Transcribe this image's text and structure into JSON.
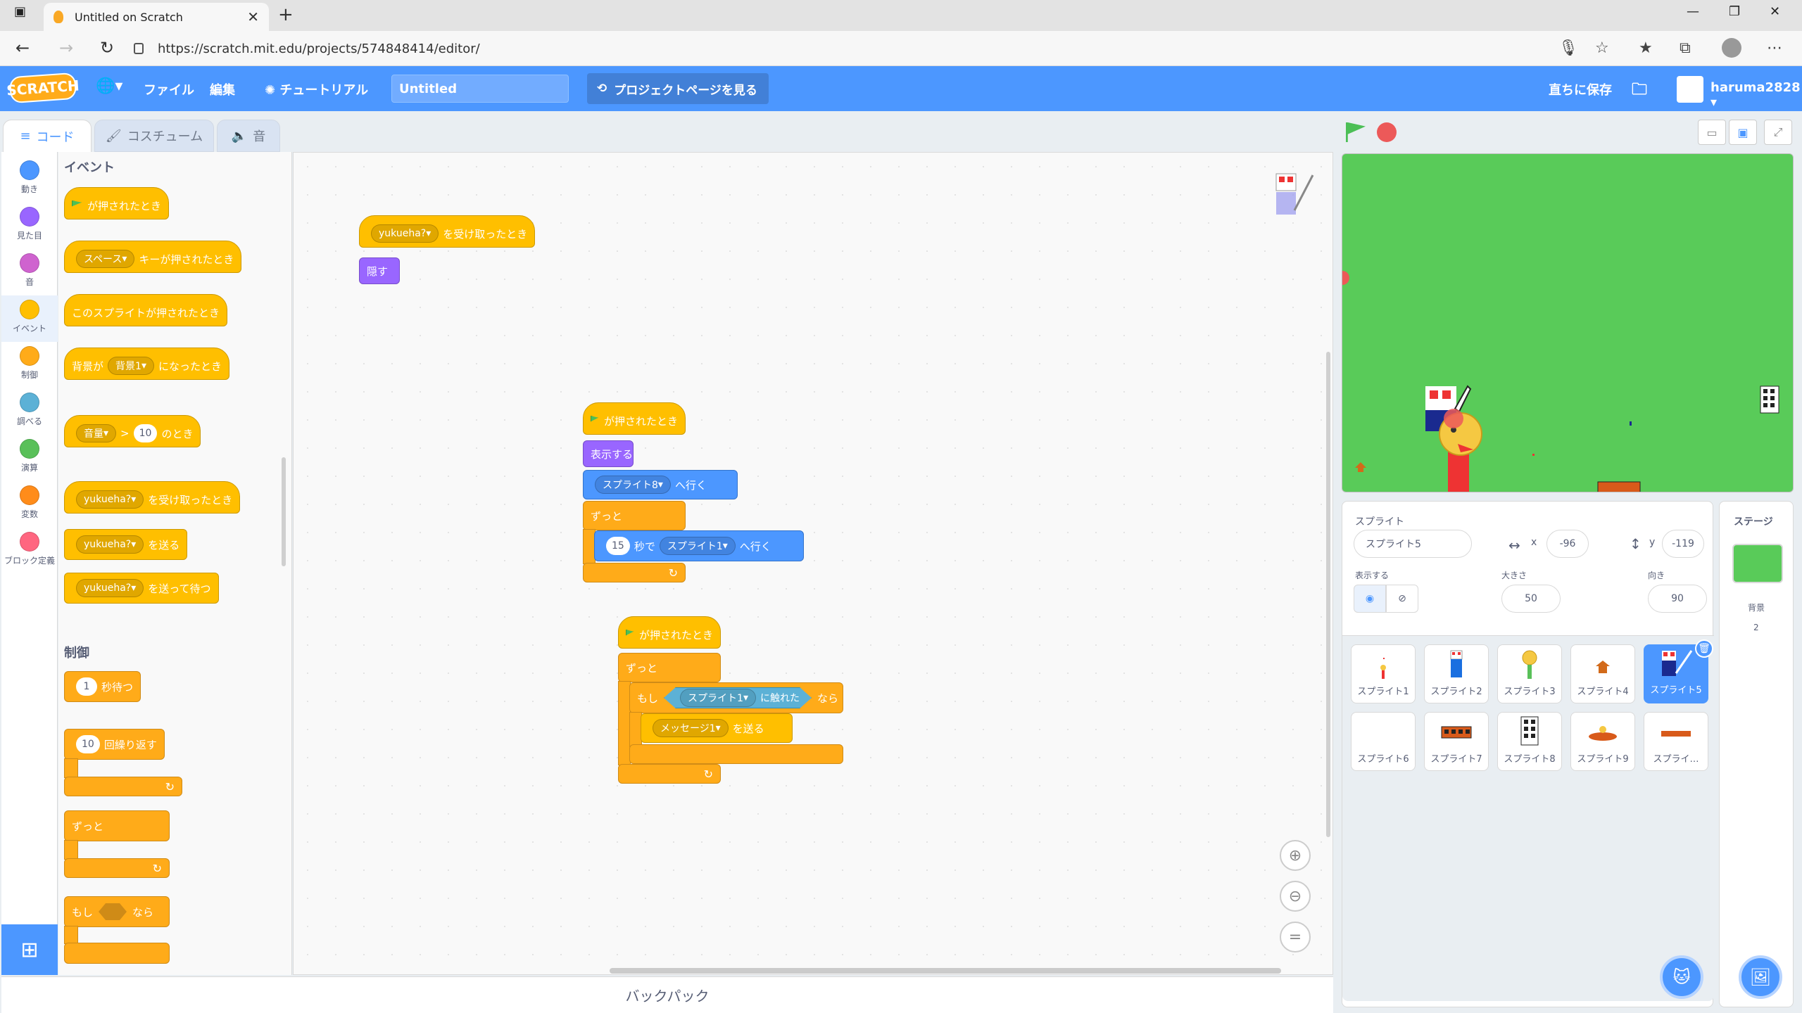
{
  "browser": {
    "tab_title": "Untitled on Scratch",
    "url": "https://scratch.mit.edu/projects/574848414/editor/"
  },
  "menubar": {
    "logo": "SCRATCH",
    "file": "ファイル",
    "edit": "編集",
    "tutorial": "チュートリアル",
    "project_title": "Untitled",
    "project_page": "プロジェクトページを見る",
    "save_now": "直ちに保存",
    "username": "haruma2828"
  },
  "tabs": {
    "code": "コード",
    "costume": "コスチューム",
    "sound": "音"
  },
  "categories": [
    {
      "label": "動き",
      "color": "#4c97ff"
    },
    {
      "label": "見た目",
      "color": "#9966ff"
    },
    {
      "label": "音",
      "color": "#cf63cf"
    },
    {
      "label": "イベント",
      "color": "#ffbf00"
    },
    {
      "label": "制御",
      "color": "#ffab19"
    },
    {
      "label": "調べる",
      "color": "#5cb1d6"
    },
    {
      "label": "演算",
      "color": "#59c059"
    },
    {
      "label": "変数",
      "color": "#ff8c1a"
    },
    {
      "label": "ブロック定義",
      "color": "#ff6680"
    }
  ],
  "palette": {
    "events_heading": "イベント",
    "control_heading": "制御",
    "b_flag": "が押されたとき",
    "b_key_space": "スペース",
    "b_key_suffix": "キーが押されたとき",
    "b_sprite_clicked": "このスプライトが押されたとき",
    "b_backdrop_prefix": "背景が",
    "b_backdrop_val": "背景1",
    "b_backdrop_suffix": "になったとき",
    "b_loud_val": "音量",
    "b_gt": ">",
    "b_loud_num": "10",
    "b_loud_suffix": "のとき",
    "b_msg": "yukueha?",
    "b_receive_suffix": "を受け取ったとき",
    "b_broadcast_suffix": "を送る",
    "b_broadcast_wait_suffix": "を送って待つ",
    "b_wait_num": "1",
    "b_wait_suffix": "秒待つ",
    "b_repeat_num": "10",
    "b_repeat_suffix": "回繰り返す",
    "b_forever": "ずっと",
    "b_if": "もし",
    "b_then": "なら"
  },
  "scripts": {
    "s1_msg": "yukueha?",
    "s1_receive": "を受け取ったとき",
    "s1_hide": "隠す",
    "s2_flag": "が押されたとき",
    "s2_show": "表示する",
    "s2_goto_sprite": "スプライト8",
    "s2_goto_suffix": "へ行く",
    "s2_forever": "ずっと",
    "s2_glide_num": "15",
    "s2_glide_mid": "秒で",
    "s2_glide_sprite": "スプライト1",
    "s2_glide_suffix": "へ行く",
    "s3_flag": "が押されたとき",
    "s3_forever": "ずっと",
    "s3_if": "もし",
    "s3_touch_sprite": "スプライト1",
    "s3_touch_suffix": "に触れた",
    "s3_then": "なら",
    "s3_msg": "メッセージ1",
    "s3_broadcast": "を送る"
  },
  "sprite_info": {
    "sprite_label": "スプライト",
    "sprite_name": "スプライト5",
    "x_label": "x",
    "x_value": "-96",
    "y_label": "y",
    "y_value": "-119",
    "show_label": "表示する",
    "size_label": "大きさ",
    "size_value": "50",
    "direction_label": "向き",
    "direction_value": "90"
  },
  "stage_panel": {
    "label": "ステージ",
    "backdrop_label": "背景",
    "backdrop_count": "2"
  },
  "sprites": [
    {
      "name": "スプライト1",
      "selected": false
    },
    {
      "name": "スプライト2",
      "selected": false
    },
    {
      "name": "スプライト3",
      "selected": false
    },
    {
      "name": "スプライト4",
      "selected": false
    },
    {
      "name": "スプライト5",
      "selected": true
    },
    {
      "name": "スプライト6",
      "selected": false
    },
    {
      "name": "スプライト7",
      "selected": false
    },
    {
      "name": "スプライト8",
      "selected": false
    },
    {
      "name": "スプライト9",
      "selected": false
    },
    {
      "name": "スプライ…",
      "selected": false
    }
  ],
  "backpack": "バックパック",
  "colors": {
    "scratch_blue": "#4c97ff",
    "events": "#ffbf00",
    "control": "#ffab19",
    "stage_bg": "#59cb59"
  }
}
